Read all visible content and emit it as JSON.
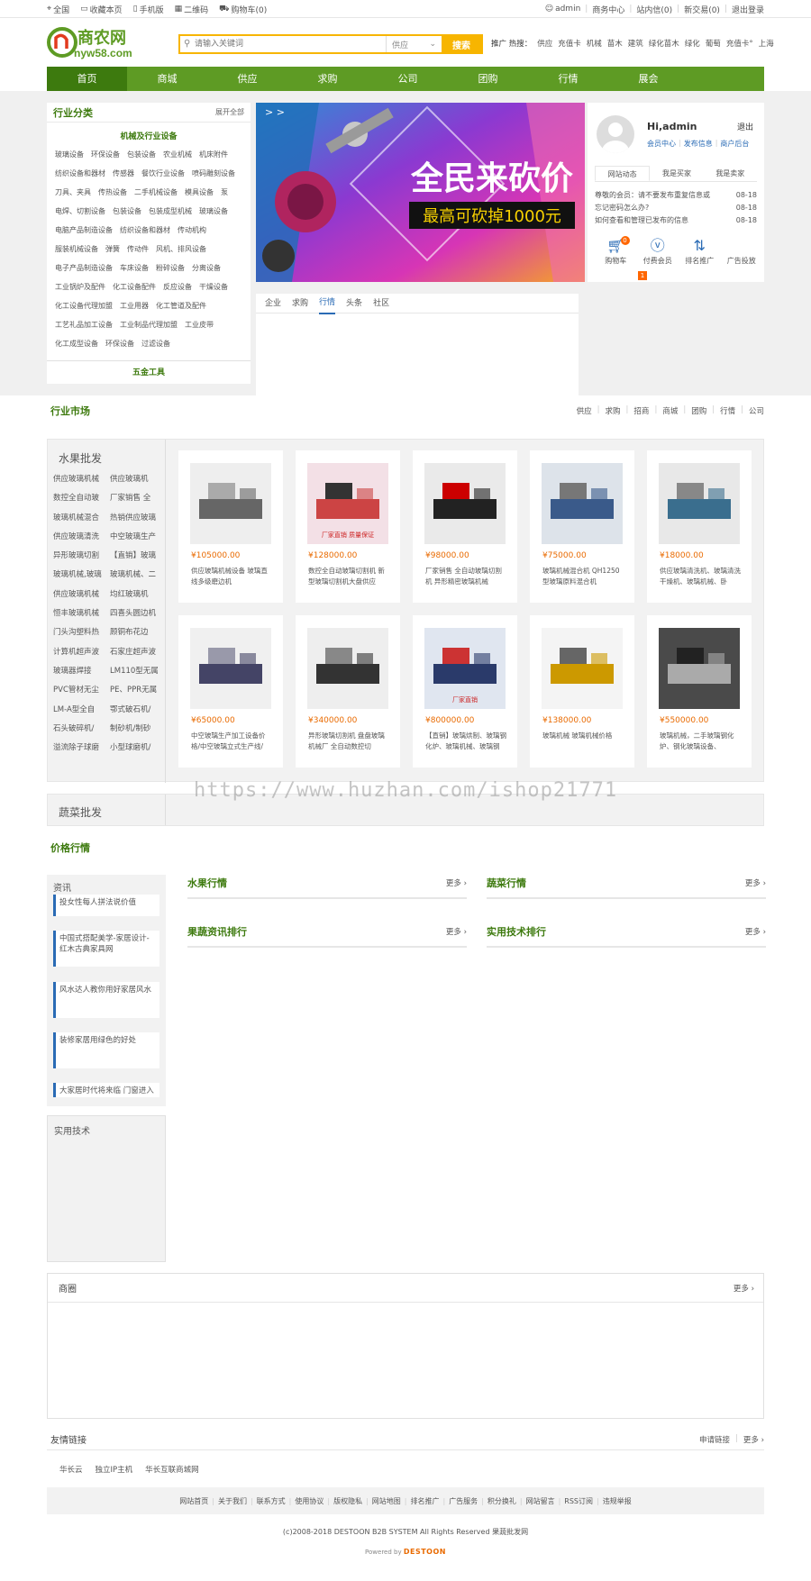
{
  "topbar": {
    "left": [
      "全国",
      "收藏本页",
      "手机版",
      "二维码",
      "购物车(0)"
    ],
    "right": [
      "admin",
      "商务中心",
      "站内信(0)",
      "新交易(0)",
      "退出登录"
    ]
  },
  "logo": {
    "main": "商农网",
    "sub": "nyw58.com"
  },
  "search": {
    "placeholder": "请输入关键词",
    "scope": "供应",
    "button": "搜索"
  },
  "hot": {
    "label": "推广 热搜：",
    "items": [
      "供应",
      "充值卡",
      "机械",
      "苗木",
      "建筑",
      "绿化苗木",
      "绿化",
      "葡萄",
      "充值卡°",
      "上海"
    ]
  },
  "nav": [
    "首页",
    "商城",
    "供应",
    "求购",
    "公司",
    "团购",
    "行情",
    "展会"
  ],
  "category": {
    "title": "行业分类",
    "expand": "展开全部",
    "subtitle": "机械及行业设备",
    "items": [
      "玻璃设备",
      "环保设备",
      "包装设备",
      "农业机械",
      "机床附件",
      "纺织设备和器材",
      "传感器",
      "餐饮行业设备",
      "喷码雕刻设备",
      "刀具、夹具",
      "传热设备",
      "二手机械设备",
      "模具设备",
      "泵",
      "电焊、切割设备",
      "包装设备",
      "包装成型机械",
      "玻璃设备",
      "电脑产品制造设备",
      "纺织设备和器材",
      "传动机构",
      "服装机械设备",
      "弹簧",
      "传动件",
      "风机、排风设备",
      "电子产品制造设备",
      "车床设备",
      "粉碎设备",
      "分离设备",
      "工业锅炉及配件",
      "化工设备配件",
      "反应设备",
      "干燥设备",
      "化工设备代理加盟",
      "工业用器",
      "化工管道及配件",
      "工艺礼品加工设备",
      "工业制品代理加盟",
      "工业皮带",
      "化工成型设备",
      "环保设备",
      "过滤设备"
    ],
    "footer": "五金工具"
  },
  "banner": {
    "headline": "全民来砍价",
    "sub": "最高可砍掉1000元"
  },
  "user": {
    "greeting": "Hi,admin",
    "logout": "退出",
    "links": [
      "会员中心",
      "发布信息",
      "商户后台"
    ],
    "tabs": [
      "网站动态",
      "我是买家",
      "我是卖家"
    ],
    "news": [
      {
        "title": "尊敬的会员：请不要发布重复信息或",
        "date": "08-18"
      },
      {
        "title": "忘记密码怎么办?",
        "date": "08-18"
      },
      {
        "title": "如何查看和管理已发布的信息",
        "date": "08-18"
      }
    ],
    "icons": [
      {
        "icon": "cart-icon",
        "label": "购物车",
        "badge": "0"
      },
      {
        "icon": "vip-icon",
        "label": "付费会员"
      },
      {
        "icon": "sort-icon",
        "label": "排名推广"
      },
      {
        "icon": "ad-icon",
        "label": "广告投放"
      }
    ],
    "marker": "1"
  },
  "tabpanel": {
    "tabs": [
      "企业",
      "求购",
      "行情",
      "头条",
      "社区"
    ],
    "active": 2
  },
  "market": {
    "title": "行业市场",
    "links": [
      "供应",
      "求购",
      "招商",
      "商城",
      "团购",
      "行情",
      "公司"
    ],
    "left_title": "水果批发",
    "tags": [
      "供应玻璃机械",
      "供应玻璃机",
      "数控全自动玻",
      "厂家销售 全",
      "玻璃机械混合",
      "热销供应玻璃",
      "供应玻璃清洗",
      "中空玻璃生产",
      "异形玻璃切割",
      "【直销】玻璃",
      "玻璃机械,玻璃",
      "玻璃机械、二",
      "供应玻璃机械",
      "均红玻璃机",
      "恒丰玻璃机械",
      "四喜头圆边机",
      "门头沟塑料热",
      "顾铜布花边",
      "计算机超声波",
      "石家庄超声波",
      "玻璃器焊接",
      "LM110型无属",
      "PVC管材无尘",
      "PE、PPR无属",
      "LM-A型全自",
      "鄂式破石机/",
      "石头破碎机/",
      "制砂机/制砂",
      "溢流除子球磨",
      "小型球磨机/"
    ],
    "products": [
      {
        "price": "¥105000.00",
        "name": "供应玻璃机械设备 玻璃直线多级磨边机"
      },
      {
        "price": "¥128000.00",
        "name": "数控全自动玻璃切割机 新型玻璃切割机大盘供应"
      },
      {
        "price": "¥98000.00",
        "name": "厂家销售 全自动玻璃切割机 异形精密玻璃机械"
      },
      {
        "price": "¥75000.00",
        "name": "玻璃机械混合机 QH1250型玻璃原料混合机"
      },
      {
        "price": "¥18000.00",
        "name": "供应玻璃清洗机、玻璃清洗干燥机、玻璃机械、卧"
      },
      {
        "price": "¥65000.00",
        "name": "中空玻璃生产加工设备价格/中空玻璃立式生产线/"
      },
      {
        "price": "¥340000.00",
        "name": "异形玻璃切割机 盘盘玻璃机械厂 全自动数控切"
      },
      {
        "price": "¥800000.00",
        "name": "【直销】玻璃烘制、玻璃钢化炉、玻璃机械、玻璃钢"
      },
      {
        "price": "¥138000.00",
        "name": "玻璃机械 玻璃机械价格"
      },
      {
        "price": "¥550000.00",
        "name": "玻璃机械，二手玻璃钢化炉、钢化玻璃设备、"
      }
    ],
    "img_texts": [
      "",
      "厂家直销 质量保证",
      "",
      "",
      "",
      "",
      "",
      "厂家直销",
      "",
      ""
    ],
    "veg_title": "蔬菜批发"
  },
  "watermark": "https://www.huzhan.com/ishop21771",
  "price": {
    "title": "价格行情",
    "info_title": "资讯",
    "info_cards": [
      "投女性每人拼法说价值",
      "中国式搭配美学-家居设计-红木古典家具网",
      "风水达人教你用好家居风水",
      "装修家居用绿色的好处",
      "大家居时代将来临 门窗进入"
    ],
    "tech_title": "实用技术",
    "boxes": [
      {
        "title": "水果行情",
        "more": "更多"
      },
      {
        "title": "蔬菜行情",
        "more": "更多"
      },
      {
        "title": "果蔬资讯排行",
        "more": "更多"
      },
      {
        "title": "实用技术排行",
        "more": "更多"
      }
    ]
  },
  "shop": {
    "title": "商圈",
    "more": "更多"
  },
  "friend": {
    "title": "友情链接",
    "apply": "申请链接",
    "more": "更多",
    "links": [
      "华长云",
      "独立IP主机",
      "华长互联商城网"
    ]
  },
  "footer": {
    "nav": [
      "网站首页",
      "关于我们",
      "联系方式",
      "使用协议",
      "版权隐私",
      "网站地图",
      "排名推广",
      "广告服务",
      "积分换礼",
      "网站留言",
      "RSS订阅",
      "违规举报"
    ],
    "copyright": "(c)2008-2018 DESTOON B2B SYSTEM All Rights Reserved  果蔬批发网",
    "powered_label": "Powered by",
    "powered_brand": "DESTOON"
  },
  "colors": {
    "green": "#5e9b24",
    "dark_green": "#3d7a0e",
    "accent": "#f7b500",
    "price": "#e96a00",
    "link": "#2a6bb5"
  }
}
